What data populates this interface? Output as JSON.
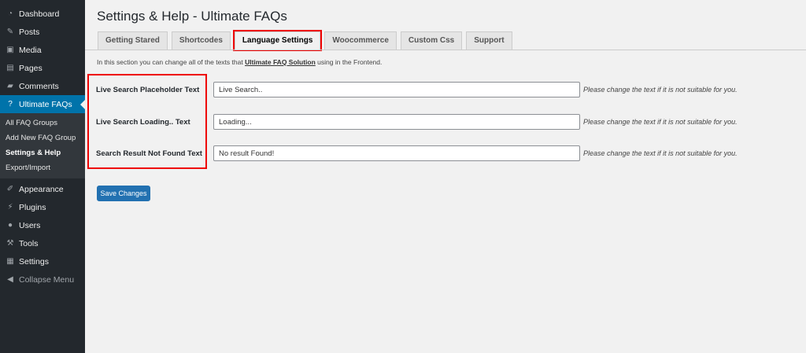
{
  "sidebar": {
    "items": [
      {
        "label": "Dashboard",
        "icon": "dashboard-icon"
      },
      {
        "label": "Posts",
        "icon": "pin-icon"
      },
      {
        "label": "Media",
        "icon": "media-icon"
      },
      {
        "label": "Pages",
        "icon": "pages-icon"
      },
      {
        "label": "Comments",
        "icon": "comment-icon"
      },
      {
        "label": "Ultimate FAQs",
        "icon": "question-icon"
      }
    ],
    "submenu": [
      "All FAQ Groups",
      "Add New FAQ Group",
      "Settings & Help",
      "Export/Import"
    ],
    "items2": [
      {
        "label": "Appearance",
        "icon": "brush-icon"
      },
      {
        "label": "Plugins",
        "icon": "plug-icon"
      },
      {
        "label": "Users",
        "icon": "user-icon"
      },
      {
        "label": "Tools",
        "icon": "wrench-icon"
      },
      {
        "label": "Settings",
        "icon": "settings-icon"
      },
      {
        "label": "Collapse Menu",
        "icon": "collapse-icon"
      }
    ]
  },
  "page": {
    "title": "Settings & Help - Ultimate FAQs",
    "tabs": [
      "Getting Stared",
      "Shortcodes",
      "Language Settings",
      "Woocommerce",
      "Custom Css",
      "Support"
    ],
    "intro_prefix": "In this section you can change all of the texts that ",
    "intro_link": "Ultimate FAQ Solution",
    "intro_suffix": " using in the Frontend.",
    "rows": [
      {
        "label": "Live Search Placeholder Text",
        "value": "Live Search..",
        "hint": "Please change the text if it is not suitable for you."
      },
      {
        "label": "Live Search Loading.. Text",
        "value": "Loading...",
        "hint": "Please change the text if it is not suitable for you."
      },
      {
        "label": "Search Result Not Found Text",
        "value": "No result Found!",
        "hint": "Please change the text if it is not suitable for you."
      }
    ],
    "save_label": "Save Changes"
  },
  "colors": {
    "sidebar": "#23282d",
    "accent": "#0073aa",
    "highlight": "#ee0000"
  }
}
